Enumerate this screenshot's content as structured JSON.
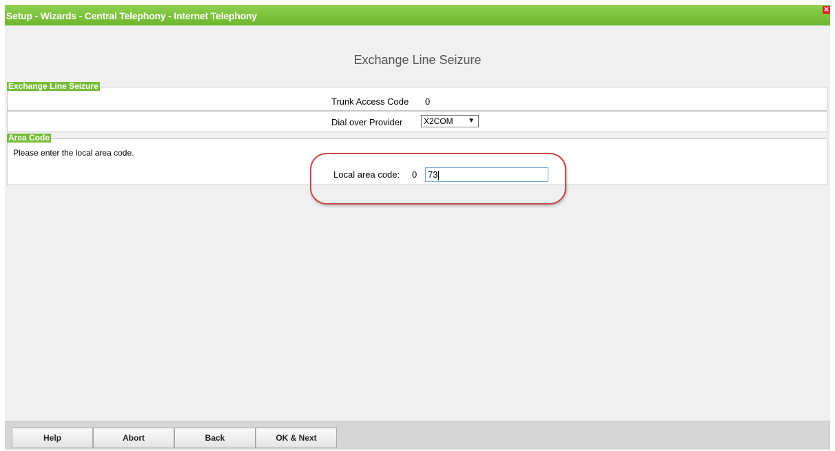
{
  "window": {
    "title": "Setup - Wizards - Central Telephony - Internet Telephony",
    "close_icon": "close-icon"
  },
  "page": {
    "heading": "Exchange Line Seizure"
  },
  "sections": {
    "exchange": {
      "legend": "Exchange Line Seizure",
      "trunk_label": "Trunk Access Code",
      "trunk_value": "0",
      "dial_label": "Dial over Provider",
      "dial_value": "X2COM",
      "dial_arrow": "▼"
    },
    "area": {
      "legend": "Area Code",
      "instruction": "Please enter the local area code.",
      "local_label": "Local area code:",
      "local_prefix": "0",
      "local_value": "73"
    }
  },
  "footer": {
    "buttons": [
      "Help",
      "Abort",
      "Back",
      "OK & Next"
    ]
  },
  "colors": {
    "accent": "#76bd37",
    "highlight": "#c9494a"
  }
}
